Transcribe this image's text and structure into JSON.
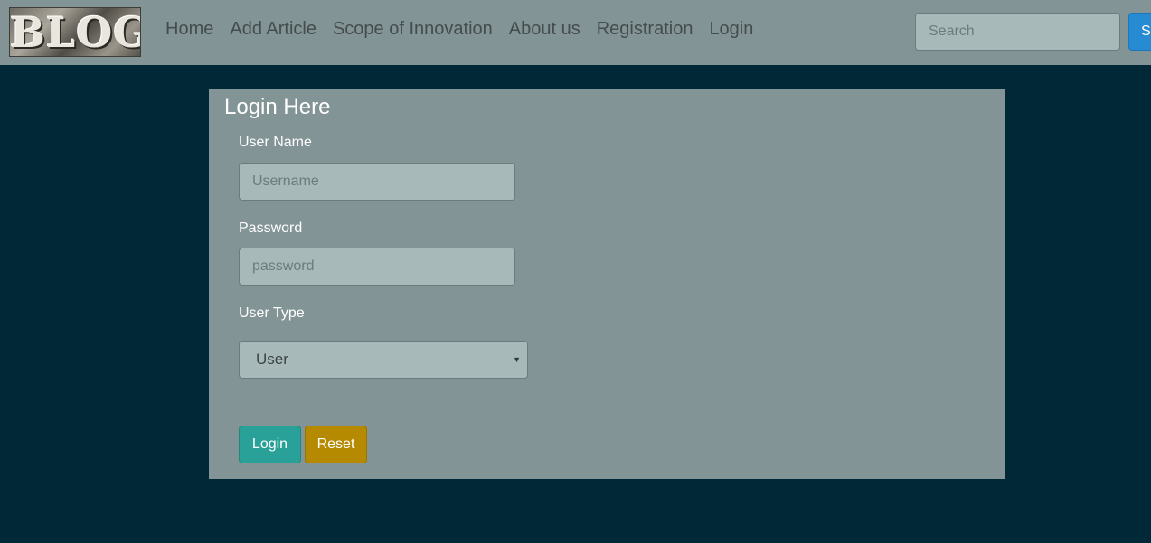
{
  "logo": {
    "text": "BLOG"
  },
  "nav": {
    "items": [
      {
        "label": "Home"
      },
      {
        "label": "Add Article"
      },
      {
        "label": "Scope of Innovation"
      },
      {
        "label": "About us"
      },
      {
        "label": "Registration"
      },
      {
        "label": "Login"
      }
    ],
    "search_placeholder": "Search",
    "search_button_label": "Se"
  },
  "login_form": {
    "title": "Login Here",
    "username_label": "User Name",
    "username_placeholder": "Username",
    "password_label": "Password",
    "password_placeholder": "password",
    "user_type_label": "User Type",
    "user_type_selected": "User",
    "login_button_label": "Login",
    "reset_button_label": "Reset"
  },
  "colors": {
    "page_background": "#002837",
    "navbar_background": "#839496",
    "panel_background": "#839496",
    "input_background": "#a7b9b9",
    "search_button": "#268bd2",
    "login_button": "#2aa198",
    "reset_button": "#b58900"
  },
  "icons": {
    "select_caret": "caret-down-icon"
  }
}
